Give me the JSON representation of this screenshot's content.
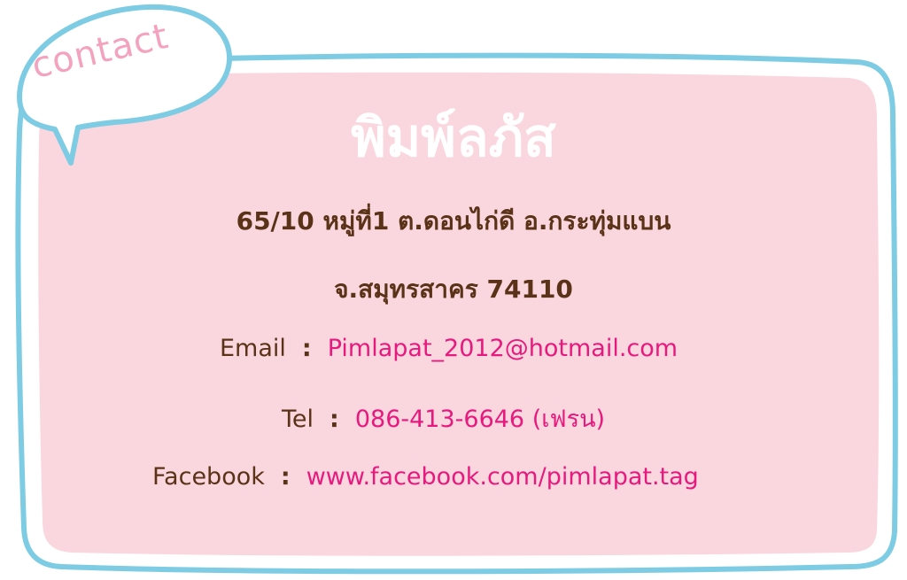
{
  "bubble": {
    "label": "contact"
  },
  "card": {
    "title": "พิมพ์ลภัส",
    "address_line1": "65/10 หมู่ที่1 ต.ดอนไก่ดี อ.กระทุ่มแบน",
    "address_line2": "จ.สมุทรสาคร 74110",
    "email": {
      "label": "Email",
      "separator": ":",
      "value": "Pimlapat_2012@hotmail.com"
    },
    "tel": {
      "label": "Tel",
      "separator": ":",
      "value": "086-413-6646 (เฟรน)"
    },
    "facebook": {
      "label": "Facebook",
      "separator": ":",
      "value": "www.facebook.com/pimlapat.tag"
    }
  },
  "colors": {
    "card_fill": "#fad7de",
    "card_border": "#7ecbe4",
    "text_brown": "#5a3217",
    "text_pink": "#e8197e",
    "bubble_text": "#f4a3bf"
  }
}
